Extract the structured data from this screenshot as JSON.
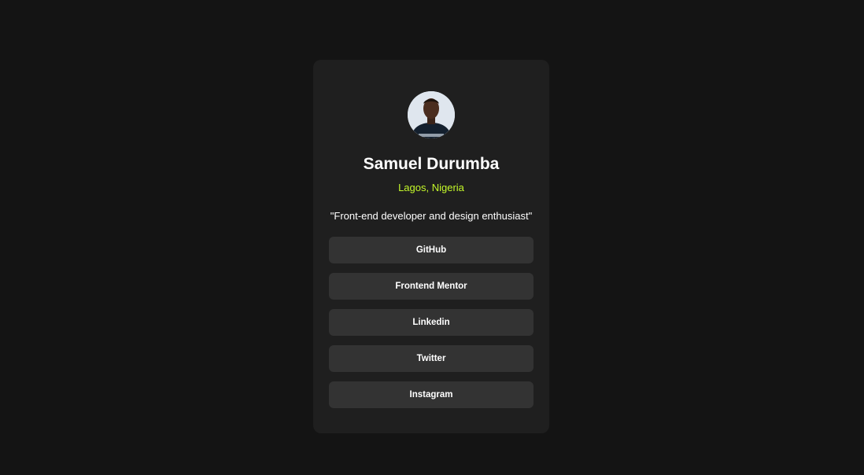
{
  "profile": {
    "name": "Samuel Durumba",
    "location": "Lagos, Nigeria",
    "bio": "\"Front-end developer and design enthusiast\""
  },
  "links": [
    {
      "label": "GitHub"
    },
    {
      "label": "Frontend Mentor"
    },
    {
      "label": "Linkedin"
    },
    {
      "label": "Twitter"
    },
    {
      "label": "Instagram"
    }
  ],
  "colors": {
    "page_background": "#141414",
    "card_background": "#1f1f1f",
    "button_background": "#333333",
    "accent": "#c4f82a",
    "text": "#ffffff"
  }
}
